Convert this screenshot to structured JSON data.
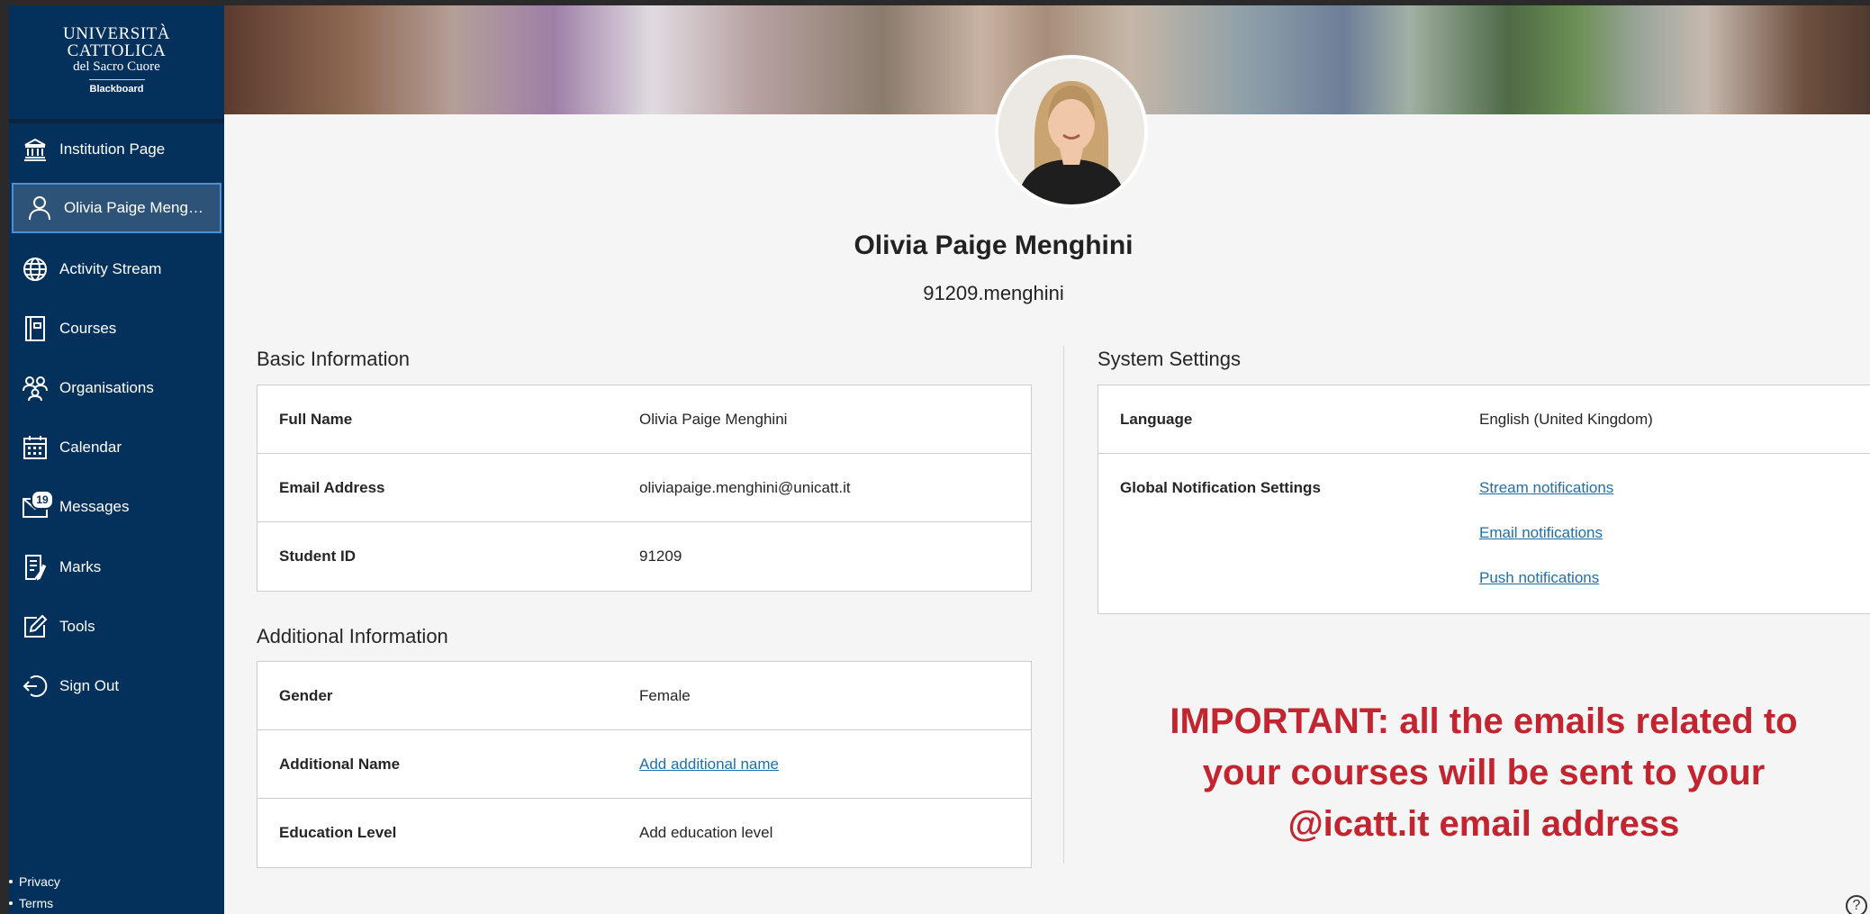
{
  "logo": {
    "line1": "UNIVERSITÀ",
    "line2": "CATTOLICA",
    "line3": "del Sacro Cuore",
    "line4": "Blackboard"
  },
  "sidebar": {
    "items": [
      {
        "label": "Institution Page",
        "icon": "institution-icon"
      },
      {
        "label": "Olivia Paige Mengh...",
        "icon": "user-icon",
        "active": true
      },
      {
        "label": "Activity Stream",
        "icon": "globe-icon"
      },
      {
        "label": "Courses",
        "icon": "courses-icon"
      },
      {
        "label": "Organisations",
        "icon": "organisations-icon"
      },
      {
        "label": "Calendar",
        "icon": "calendar-icon"
      },
      {
        "label": "Messages",
        "icon": "envelope-icon",
        "badge": "19"
      },
      {
        "label": "Marks",
        "icon": "marks-icon"
      },
      {
        "label": "Tools",
        "icon": "tools-icon"
      },
      {
        "label": "Sign Out",
        "icon": "sign-out-icon"
      }
    ],
    "footer": [
      "Privacy",
      "Terms"
    ]
  },
  "profile": {
    "name": "Olivia Paige Menghini",
    "username": "91209.menghini"
  },
  "basic_info": {
    "title": "Basic Information",
    "rows": [
      {
        "label": "Full Name",
        "value": "Olivia Paige Menghini"
      },
      {
        "label": "Email Address",
        "value": "oliviapaige.menghini@unicatt.it"
      },
      {
        "label": "Student ID",
        "value": "91209"
      }
    ]
  },
  "additional_info": {
    "title": "Additional Information",
    "rows": [
      {
        "label": "Gender",
        "value": "Female"
      },
      {
        "label": "Additional Name",
        "value": "Add additional name"
      },
      {
        "label": "Education Level",
        "value": "Add education level"
      }
    ]
  },
  "system_settings": {
    "title": "System Settings",
    "language_label": "Language",
    "language_value": "English (United Kingdom)",
    "notifications_label": "Global Notification Settings",
    "links": [
      "Stream notifications",
      "Email notifications",
      "Push notifications"
    ]
  },
  "notice": {
    "line1": "IMPORTANT: all the emails related to",
    "line2": "your courses will be sent to your",
    "line3": "@icatt.it email address"
  },
  "help": "?",
  "colors": {
    "sidebar": "#04305c",
    "active_item": "#2e5379",
    "notice": "#c2252f",
    "link": "#1f6fa8"
  }
}
